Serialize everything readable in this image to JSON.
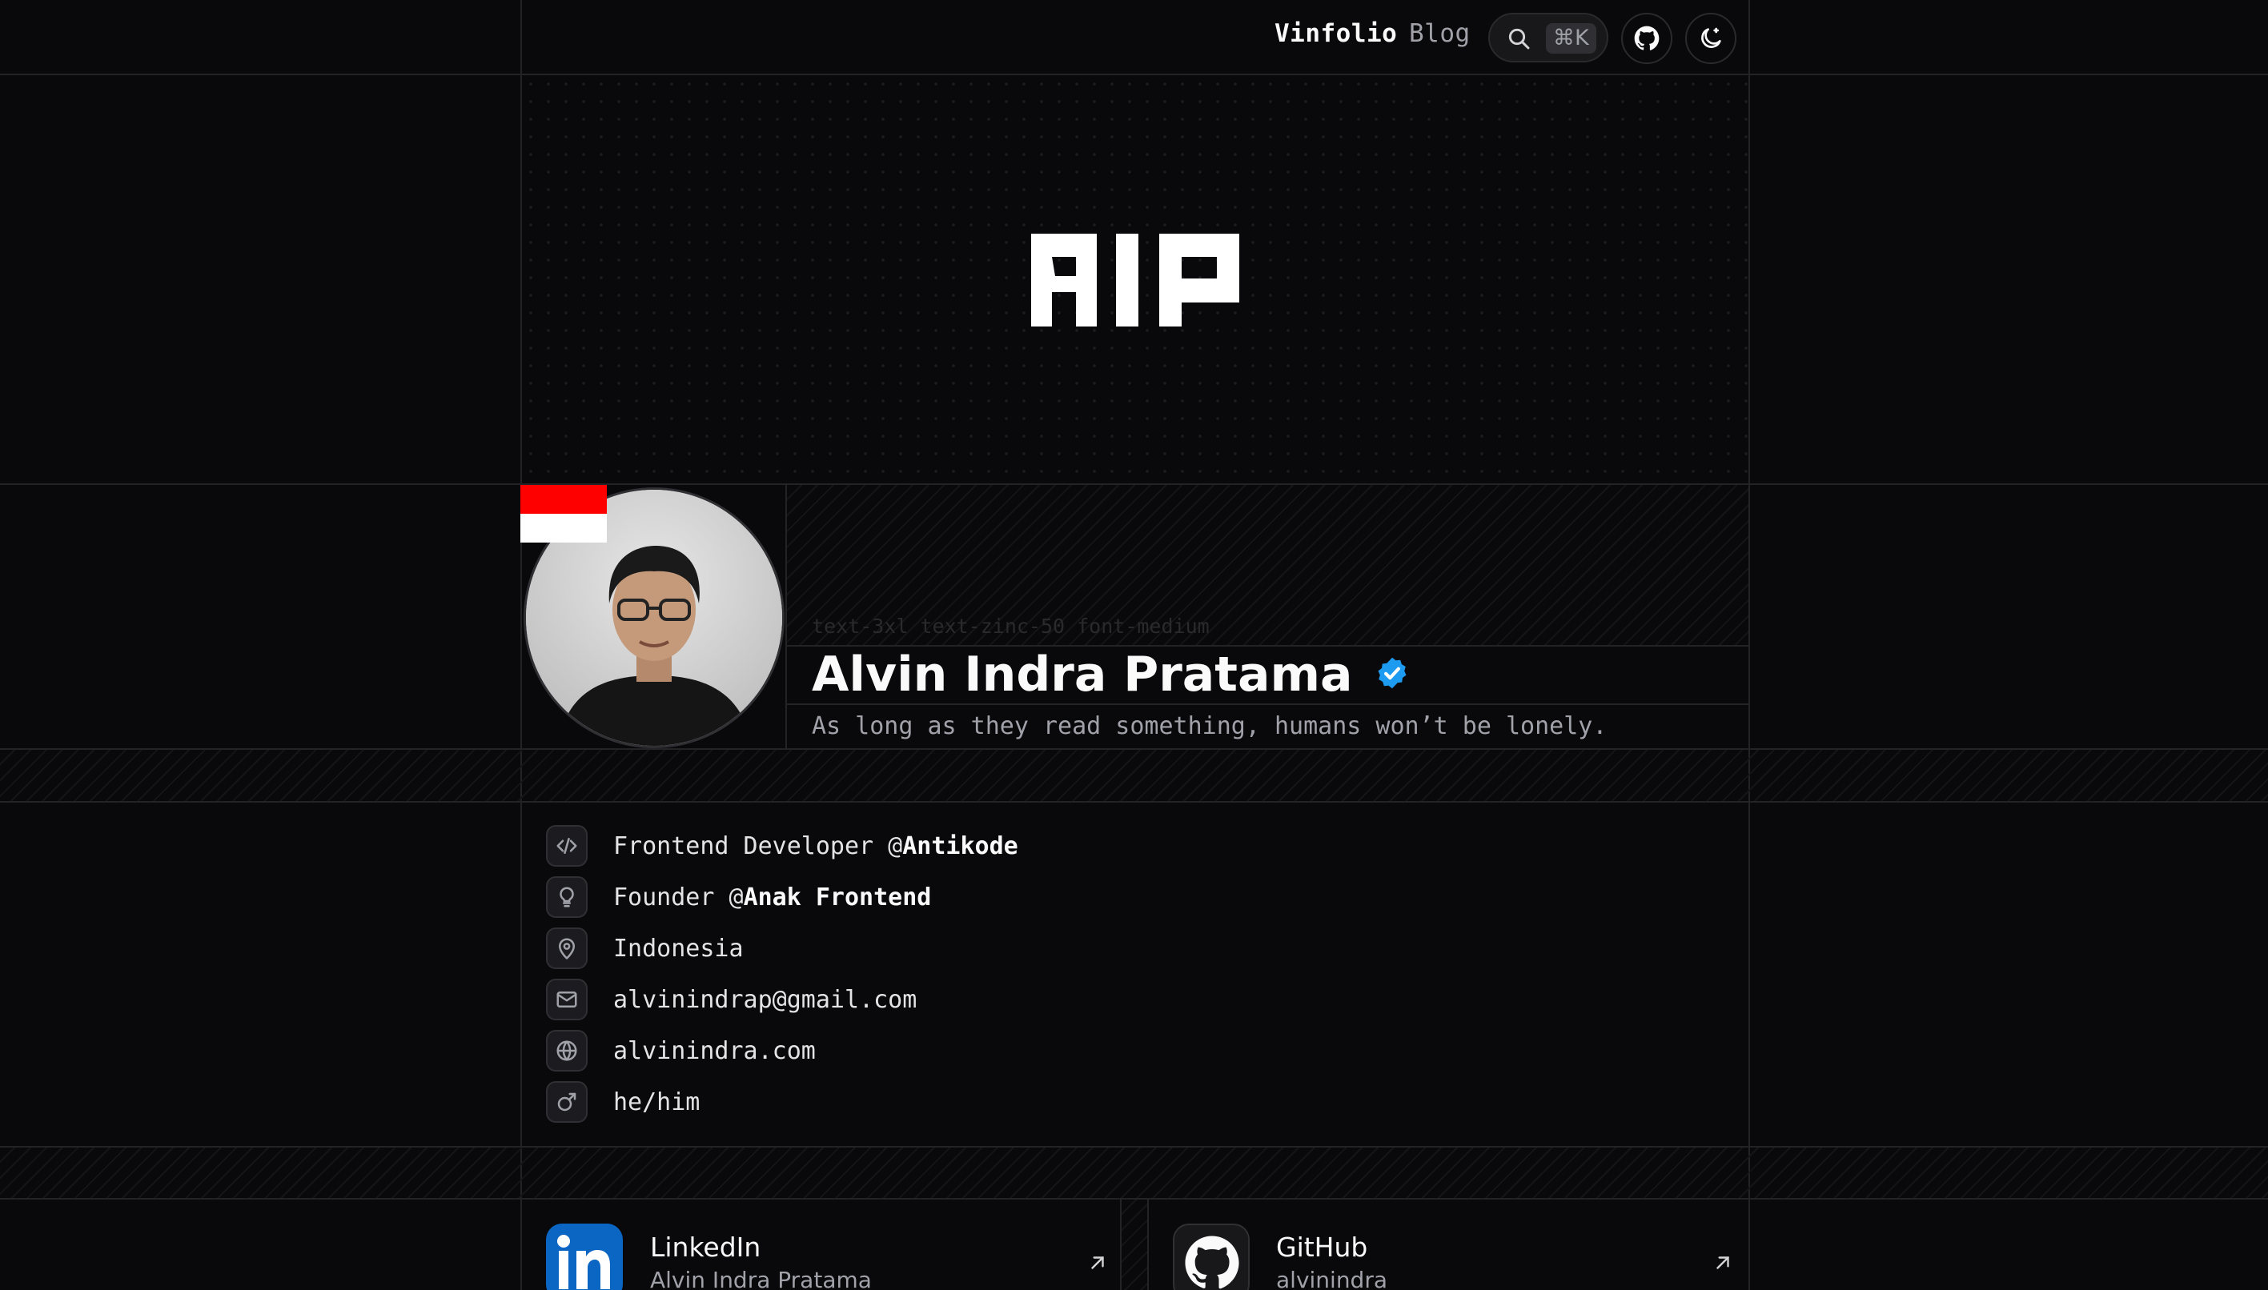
{
  "nav": {
    "brand": "Vinfolio",
    "blog": "Blog",
    "search_shortcut": "⌘K",
    "icons": [
      "search-icon",
      "github-icon",
      "theme-toggle-icon"
    ]
  },
  "hero": {
    "logo_text": "AIP"
  },
  "profile": {
    "ghost_label": "text-3xl text-zinc-50 font-medium",
    "name": "Alvin Indra Pratama",
    "tagline": "As long as they read something, humans won’t be lonely.",
    "flag": "Indonesia flag",
    "verified_color": "#1d9bf0"
  },
  "info": [
    {
      "icon": "code-icon",
      "prefix": "Frontend Developer @",
      "strong": "Antikode"
    },
    {
      "icon": "lightbulb-icon",
      "prefix": "Founder @",
      "strong": "Anak Frontend"
    },
    {
      "icon": "map-pin-icon",
      "prefix": "Indonesia",
      "strong": ""
    },
    {
      "icon": "mail-icon",
      "prefix": "alvinindrap@gmail.com",
      "strong": ""
    },
    {
      "icon": "globe-icon",
      "prefix": "alvinindra.com",
      "strong": ""
    },
    {
      "icon": "male-icon",
      "prefix": "he/him",
      "strong": ""
    }
  ],
  "social": [
    {
      "icon": "linkedin-icon",
      "title": "LinkedIn",
      "subtitle": "Alvin Indra Pratama",
      "color": "#0a66c2"
    },
    {
      "icon": "github-icon",
      "title": "GitHub",
      "subtitle": "alvinindra",
      "color": "#18181b"
    }
  ],
  "colors": {
    "background": "#09090b",
    "border": "#232326",
    "text": "#fafafa",
    "muted": "#a1a1aa"
  }
}
